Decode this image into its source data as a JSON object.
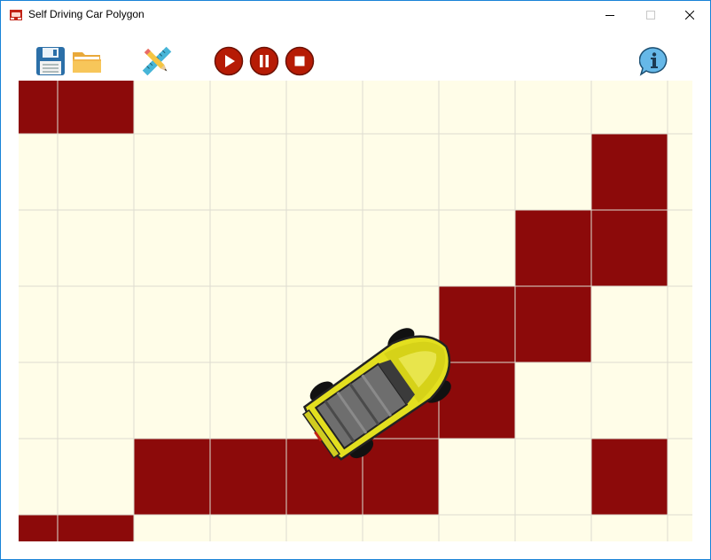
{
  "window": {
    "title": "Self Driving Car Polygon",
    "controls": [
      "minimize-icon",
      "maximize-icon",
      "close-icon"
    ]
  },
  "toolbar": {
    "buttons": [
      {
        "name": "save",
        "icon": "floppy-disk-icon"
      },
      {
        "name": "open",
        "icon": "folder-icon"
      },
      {
        "name": "edit-map",
        "icon": "ruler-pencil-icon"
      },
      {
        "name": "play",
        "icon": "play-icon"
      },
      {
        "name": "pause",
        "icon": "pause-icon"
      },
      {
        "name": "stop",
        "icon": "stop-icon"
      },
      {
        "name": "info",
        "icon": "info-bubble-icon"
      }
    ]
  },
  "map": {
    "colors": {
      "road": "#fffde8",
      "wall": "#8c0a0a",
      "grid": "#dcdcd0",
      "car_body": "#e3df1f",
      "control_button": "#b61b05"
    },
    "walls": [
      {
        "row": 0,
        "cols": [
          0,
          1
        ]
      },
      {
        "row": 1,
        "cols": [
          8
        ]
      },
      {
        "row": 2,
        "cols": [
          7,
          8
        ]
      },
      {
        "row": 3,
        "cols": [
          6,
          7
        ]
      },
      {
        "row": 4,
        "cols": [
          5,
          6
        ]
      },
      {
        "row": 5,
        "cols": [
          2,
          3,
          4,
          5,
          8
        ]
      },
      {
        "row": 6,
        "cols": [
          0,
          1
        ]
      }
    ],
    "car": {
      "heading_degrees": -35
    }
  }
}
